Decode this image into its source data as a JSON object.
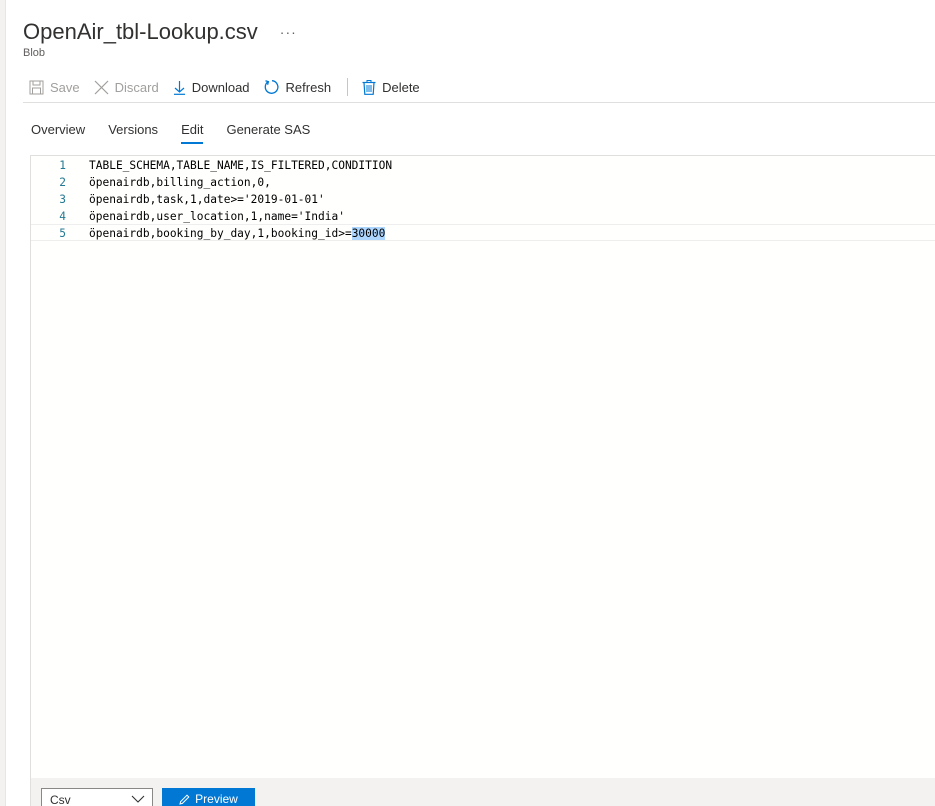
{
  "header": {
    "title": "OpenAir_tbl-Lookup.csv",
    "more_label": "···",
    "subtitle": "Blob"
  },
  "toolbar": {
    "save_label": "Save",
    "discard_label": "Discard",
    "download_label": "Download",
    "refresh_label": "Refresh",
    "delete_label": "Delete"
  },
  "tabs": [
    {
      "label": "Overview",
      "active": false
    },
    {
      "label": "Versions",
      "active": false
    },
    {
      "label": "Edit",
      "active": true
    },
    {
      "label": "Generate SAS",
      "active": false
    }
  ],
  "editor": {
    "lines": [
      {
        "number": "1",
        "text": "TABLE_SCHEMA,TABLE_NAME,IS_FILTERED,CONDITION"
      },
      {
        "number": "2",
        "text": "öpenairdb,billing_action,0,"
      },
      {
        "number": "3",
        "text": "öpenairdb,task,1,date>='2019-01-01'"
      },
      {
        "number": "4",
        "text": "öpenairdb,user_location,1,name='India'"
      },
      {
        "number": "5",
        "text_before": "öpenairdb,booking_by_day,1,booking_id>=",
        "text_selected": "30000"
      }
    ]
  },
  "footer": {
    "format_value": "Csv",
    "preview_label": "Preview"
  },
  "colors": {
    "accent": "#0078d4",
    "line_number": "#237893",
    "selection": "#add6ff"
  }
}
